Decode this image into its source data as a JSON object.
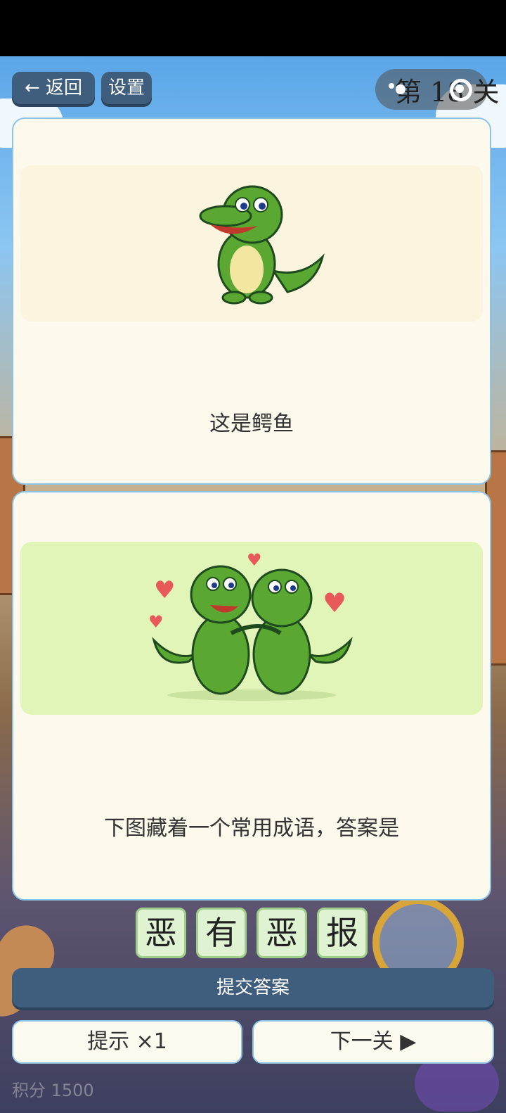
{
  "topbar": {
    "back_label": "← 返回",
    "settings_label": "设置",
    "level_label": "第 18 关"
  },
  "clue_card": {
    "image_icon": "crocodile-icon",
    "caption": "这是鳄鱼"
  },
  "puzzle_card": {
    "image_icon": "hugging-crocodiles-icon",
    "caption": "下图藏着一个常用成语，答案是"
  },
  "answer_tiles": [
    "恶",
    "有",
    "恶",
    "报"
  ],
  "buttons": {
    "submit_label": "提交答案",
    "hint_label": "提示  ×1",
    "next_label": "下一关  ▶"
  },
  "score_label": "积分 1500",
  "colors": {
    "accent": "#3f5d7c",
    "card_bg": "#fdf9ec",
    "card_border": "#8fc3e3",
    "tile_bg": "#dff3d3",
    "croc_green": "#5aa832"
  }
}
